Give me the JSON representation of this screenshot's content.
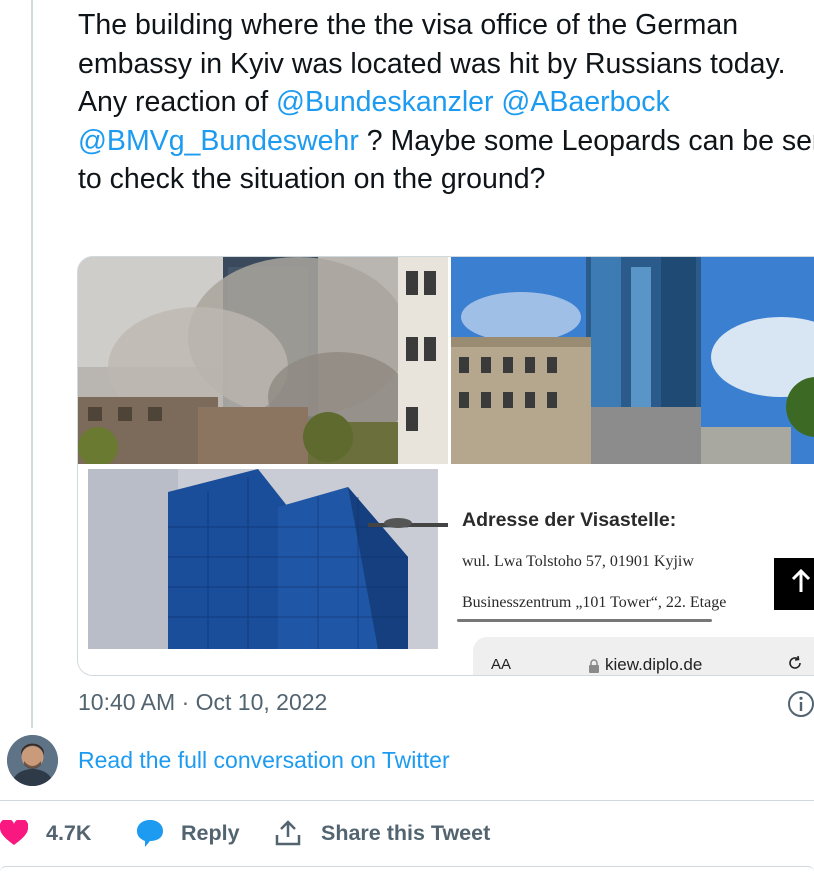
{
  "tweet": {
    "text_before": "The building where the the visa office of the German embassy in Kyiv was located was hit by Russians today. Any reaction of ",
    "mention_1": "@Bundeskanzler",
    "mention_2": "@ABaerbock",
    "mention_3": "@BMVg_Bundeswehr",
    "text_after": " ? Maybe some Leopards can be sent to check the situation on the ground?",
    "timestamp": "10:40 AM · Oct 10, 2022"
  },
  "screenshot": {
    "heading": "Adresse der Visastelle:",
    "address_line": "wul. Lwa Tolstoho 57, 01901 Kyjiw",
    "business_line": "Businesszentrum „101 Tower“, 22. Etage",
    "text_size_label": "AA",
    "url": "kiew.diplo.de"
  },
  "conversation": {
    "read_full": "Read the full conversation on Twitter"
  },
  "actions": {
    "likes": "4.7K",
    "reply": "Reply",
    "share": "Share this Tweet"
  },
  "colors": {
    "link": "#1d9bf0",
    "heart": "#f91880",
    "muted": "#536471",
    "border": "#cfd9de"
  },
  "icons": [
    "heart-icon",
    "reply-bubble-icon",
    "share-icon",
    "info-icon",
    "up-arrow-icon",
    "lock-icon",
    "reload-icon"
  ]
}
